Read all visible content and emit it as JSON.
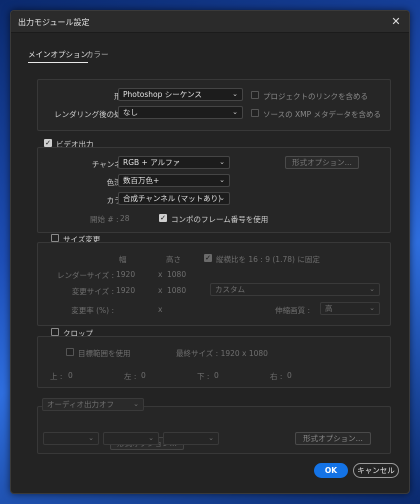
{
  "window": {
    "title": "出力モジュール設定",
    "close_glyph": "✕"
  },
  "tabs": [
    {
      "label": "メインオプション"
    },
    {
      "label": "カラー"
    }
  ],
  "format": {
    "format_label": "形式 :",
    "format_value": "Photoshop シーケンス",
    "include_project_link": "プロジェクトのリンクを含める",
    "post_render_label": "レンダリング後の処理 :",
    "post_render_value": "なし",
    "include_xmp": "ソースの XMP メタデータを含める"
  },
  "video": {
    "section_label": "ビデオ出力",
    "channel_label": "チャンネル :",
    "channel_value": "RGB + アルファ",
    "depth_label": "色深度 :",
    "depth_value": "数百万色+",
    "color_label": "カラー :",
    "color_value": "合成チャンネル (マットあり)",
    "format_options_button": "形式オプション...",
    "start_label": "開始 # :",
    "start_value": "28",
    "use_comp_frame": "コンポのフレーム番号を使用"
  },
  "resize": {
    "section_label": "サイズ変更",
    "width_header": "幅",
    "height_header": "高さ",
    "lock_aspect": "縦横比を 16 : 9 (1.78) に固定",
    "render_size_label": "レンダーサイズ :",
    "render_w": "1920",
    "render_x": "x",
    "render_h": "1080",
    "resize_to_label": "変更サイズ :",
    "resize_w": "1920",
    "resize_x": "x",
    "resize_h": "1080",
    "preset_value": "カスタム",
    "percent_label": "変更率 (%) :",
    "percent_x": "x",
    "quality_label": "伸縮画質 :",
    "quality_value": "高"
  },
  "crop": {
    "section_label": "クロップ",
    "use_roi": "目標範囲を使用",
    "final_size": "最終サイズ : 1920 x 1080",
    "top_label": "上 :",
    "top_value": "0",
    "left_label": "左 :",
    "left_value": "0",
    "bottom_label": "下 :",
    "bottom_value": "0",
    "right_label": "右 :",
    "right_value": "0"
  },
  "audio": {
    "auto_output": "オーディオ出力オフ",
    "format_options_button": "形式オプション..."
  },
  "footer": {
    "ok_label": "OK",
    "cancel_label": "キャンセル"
  },
  "colors": {
    "accent": "#1473e6",
    "dialog_bg": "#232323"
  },
  "icons": {
    "checkmark": "✓",
    "chevron": "⌄"
  }
}
